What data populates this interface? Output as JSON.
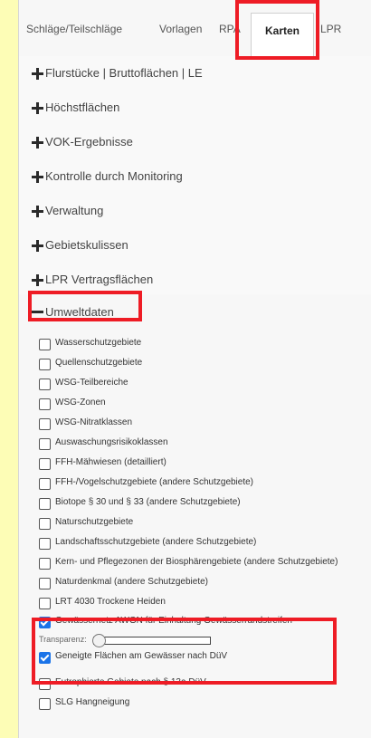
{
  "tabs": [
    {
      "label": "Schläge/Teilschläge"
    },
    {
      "label": "Vorlagen"
    },
    {
      "label": "RPA"
    },
    {
      "label": "Karten"
    },
    {
      "label": "LPR"
    }
  ],
  "sections": [
    {
      "label": "Flurstücke | Bruttoflächen | LE",
      "state": "collapsed"
    },
    {
      "label": "Höchstflächen",
      "state": "collapsed"
    },
    {
      "label": "VOK-Ergebnisse",
      "state": "collapsed"
    },
    {
      "label": "Kontrolle durch Monitoring",
      "state": "collapsed"
    },
    {
      "label": "Verwaltung",
      "state": "collapsed"
    },
    {
      "label": "Gebietskulissen",
      "state": "collapsed"
    },
    {
      "label": "LPR Vertragsflächen",
      "state": "collapsed"
    },
    {
      "label": "Umweltdaten",
      "state": "expanded"
    }
  ],
  "layers": [
    {
      "label": "Wasserschutzgebiete",
      "checked": false
    },
    {
      "label": "Quellenschutzgebiete",
      "checked": false
    },
    {
      "label": "WSG-Teilbereiche",
      "checked": false
    },
    {
      "label": "WSG-Zonen",
      "checked": false
    },
    {
      "label": "WSG-Nitratklassen",
      "checked": false
    },
    {
      "label": "Auswaschungsrisikoklassen",
      "checked": false
    },
    {
      "label": "FFH-Mähwiesen (detailliert)",
      "checked": false
    },
    {
      "label": "FFH-/Vogelschutzgebiete (andere Schutzgebiete)",
      "checked": false
    },
    {
      "label": "Biotope § 30 und § 33 (andere Schutzgebiete)",
      "checked": false
    },
    {
      "label": "Naturschutzgebiete",
      "checked": false
    },
    {
      "label": "Landschaftsschutzgebiete (andere Schutzgebiete)",
      "checked": false
    },
    {
      "label": "Kern- und Pflegezonen der Biosphärengebiete (andere Schutzgebiete)",
      "checked": false
    },
    {
      "label": "Naturdenkmal (andere Schutzgebiete)",
      "checked": false
    },
    {
      "label": "LRT 4030 Trockene Heiden",
      "checked": false
    },
    {
      "label": "Gewässernetz AWGN für Einhaltung Gewässerrandstreifen",
      "checked": true
    },
    {
      "label": "Geneigte Flächen am Gewässer nach DüV",
      "checked": true
    },
    {
      "label": "Eutrophierte Gebiete nach § 13a DüV",
      "checked": false
    },
    {
      "label": "SLG Hangneigung",
      "checked": false
    }
  ],
  "transparency": {
    "label": "Transparenz:",
    "value": 0
  },
  "colors": {
    "background": "#fdfdb6",
    "highlight": "#ee1c25",
    "checkbox": "#1a73e8"
  }
}
